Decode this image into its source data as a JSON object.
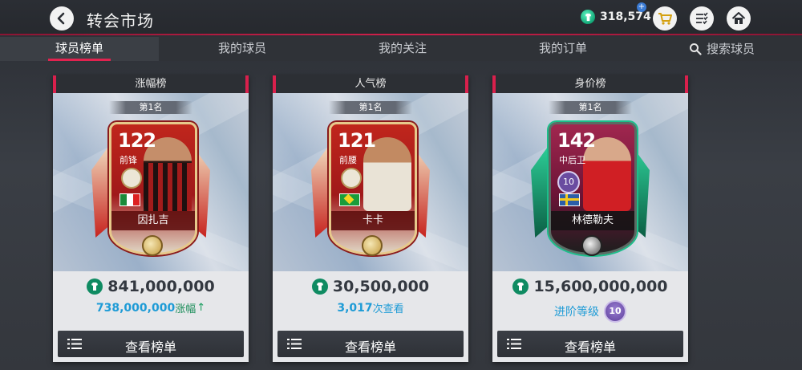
{
  "header": {
    "title": "转会市场",
    "coins": "318,574",
    "back_icon": "back-arrow-icon",
    "shop_icon": "shopping-cart-icon",
    "list_icon": "checklist-icon",
    "home_icon": "home-icon"
  },
  "tabs": [
    {
      "label": "球员榜单",
      "active": true
    },
    {
      "label": "我的球员",
      "active": false
    },
    {
      "label": "我的关注",
      "active": false
    },
    {
      "label": "我的订单",
      "active": false
    },
    {
      "label": "搜索球员",
      "active": false,
      "icon": "search-icon"
    }
  ],
  "cards": [
    {
      "header": "涨幅榜",
      "rank": "第1名",
      "rating": "122",
      "position": "前锋",
      "player_name": "因扎吉",
      "price": "841,000,000",
      "sub_value": "738,000,000",
      "sub_suffix": "涨幅",
      "sub_arrow": "↑",
      "button_label": "查看榜单"
    },
    {
      "header": "人气榜",
      "rank": "第1名",
      "rating": "121",
      "position": "前腰",
      "player_name": "卡卡",
      "price": "30,500,000",
      "sub_value": "3,017",
      "sub_suffix": "次查看",
      "button_label": "查看榜单"
    },
    {
      "header": "身价榜",
      "rank": "第1名",
      "rating": "142",
      "position": "中后卫",
      "player_name": "林德勒夫",
      "card_level": "10",
      "price": "15,600,000,000",
      "sub_text": "进阶等级",
      "advance_level": "10",
      "button_label": "查看榜单"
    }
  ],
  "colors": {
    "accent": "#e2234f",
    "coin_green": "#0f8b62",
    "link_blue": "#1e9bd6"
  }
}
